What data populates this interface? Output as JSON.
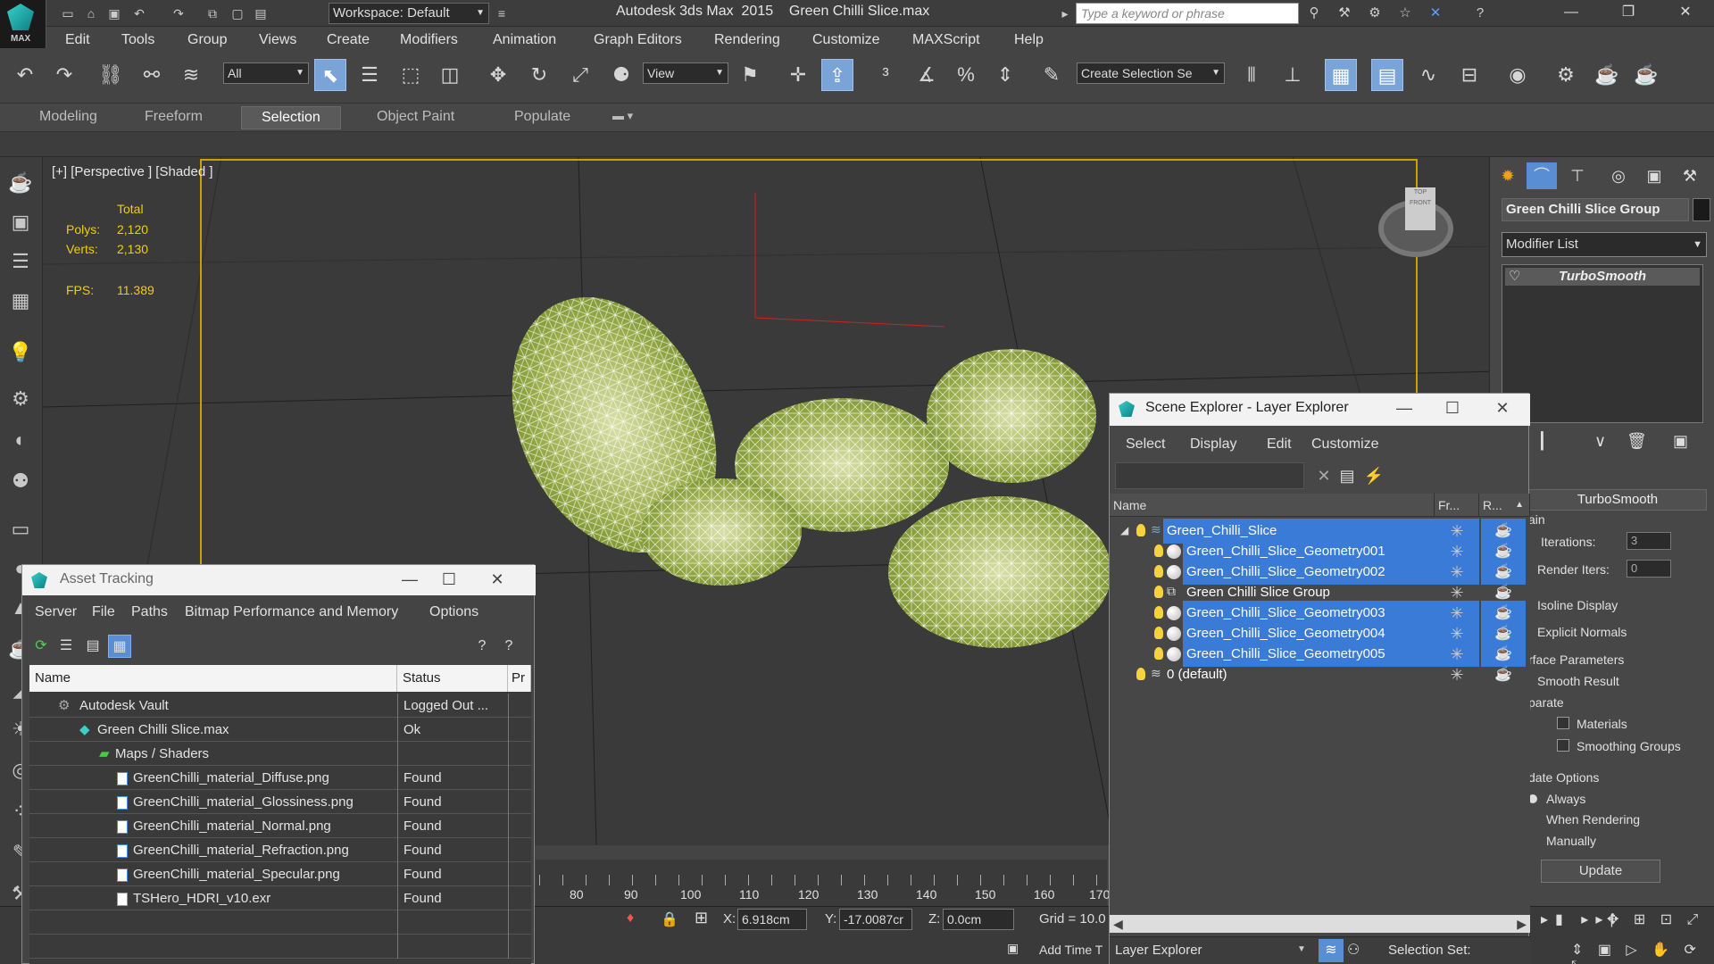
{
  "app": {
    "logo_text": "MAX",
    "title": "Autodesk 3ds Max  2015    Green Chilli Slice.max",
    "workspace": "Workspace: Default",
    "search_placeholder": "Type a keyword or phrase"
  },
  "menus": [
    "Edit",
    "Tools",
    "Group",
    "Views",
    "Create",
    "Modifiers",
    "Animation",
    "Graph Editors",
    "Rendering",
    "Customize",
    "MAXScript",
    "Help"
  ],
  "toolbar": {
    "selection_filter": "All",
    "ref_coord": "View",
    "selection_set": "Create Selection Se"
  },
  "ribbon": {
    "tabs": [
      "Modeling",
      "Freeform",
      "Selection",
      "Object Paint",
      "Populate"
    ],
    "active": "Selection"
  },
  "viewport": {
    "label": "[+] [Perspective ] [Shaded ]",
    "stats": {
      "total_label": "Total",
      "polys_label": "Polys:",
      "polys": "2,120",
      "verts_label": "Verts:",
      "verts": "2,130",
      "fps_label": "FPS:",
      "fps": "11.389"
    },
    "viewcube": {
      "top": "TOP",
      "front": "FRONT"
    }
  },
  "command_panel": {
    "object_name": "Green Chilli Slice Group",
    "modifier_list": "Modifier List",
    "stack_item": "TurboSmooth",
    "rollout_title": "TurboSmooth",
    "main_label": "ain",
    "iterations_label": "Iterations:",
    "iterations": "3",
    "render_iters_label": "Render Iters:",
    "render_iters": "0",
    "isoline": "Isoline Display",
    "explicit": "Explicit Normals",
    "surface_params": "rface Parameters",
    "smooth_result": "Smooth Result",
    "separate": "parate",
    "materials": "Materials",
    "smoothing_groups": "Smoothing Groups",
    "update_options": "date Options",
    "always": "Always",
    "when_rendering": "When Rendering",
    "manually": "Manually",
    "update_button": "Update"
  },
  "timeline": {
    "ticks": [
      "80",
      "90",
      "100",
      "110",
      "120",
      "130",
      "140",
      "150",
      "160",
      "170"
    ]
  },
  "statusbar": {
    "x_label": "X:",
    "x": "6.918cm",
    "y_label": "Y:",
    "y": "-17.0087cr",
    "z_label": "Z:",
    "z": "0.0cm",
    "grid": "Grid = 10.0",
    "add_time": "Add Time T",
    "layer_explorer": "Layer Explorer",
    "selection_set": "Selection Set:"
  },
  "asset_tracking": {
    "title": "Asset Tracking",
    "menus": [
      "Server",
      "File",
      "Paths",
      "Bitmap Performance and Memory",
      "Options"
    ],
    "columns": [
      "Name",
      "Status",
      "Pr"
    ],
    "rows": [
      {
        "name": "Autodesk Vault",
        "status": "Logged Out ...",
        "indent": 0
      },
      {
        "name": "Green Chilli Slice.max",
        "status": "Ok",
        "indent": 1
      },
      {
        "name": "Maps / Shaders",
        "status": "",
        "indent": 2
      },
      {
        "name": "GreenChilli_material_Diffuse.png",
        "status": "Found",
        "indent": 3
      },
      {
        "name": "GreenChilli_material_Glossiness.png",
        "status": "Found",
        "indent": 3
      },
      {
        "name": "GreenChilli_material_Normal.png",
        "status": "Found",
        "indent": 3
      },
      {
        "name": "GreenChilli_material_Refraction.png",
        "status": "Found",
        "indent": 3
      },
      {
        "name": "GreenChilli_material_Specular.png",
        "status": "Found",
        "indent": 3
      },
      {
        "name": "TSHero_HDRI_v10.exr",
        "status": "Found",
        "indent": 3
      }
    ]
  },
  "scene_explorer": {
    "title": "Scene Explorer - Layer Explorer",
    "menus": [
      "Select",
      "Display",
      "Edit",
      "Customize"
    ],
    "columns": [
      "Name",
      "Fr...",
      "R..."
    ],
    "rows": [
      {
        "name": "Green_Chilli_Slice",
        "level": 0,
        "highlight": true,
        "kind": "layer"
      },
      {
        "name": "Green_Chilli_Slice_Geometry001",
        "level": 1,
        "highlight": true,
        "kind": "mesh"
      },
      {
        "name": "Green_Chilli_Slice_Geometry002",
        "level": 1,
        "highlight": true,
        "kind": "mesh"
      },
      {
        "name": "Green Chilli Slice Group",
        "level": 1,
        "highlight": false,
        "kind": "group"
      },
      {
        "name": "Green_Chilli_Slice_Geometry003",
        "level": 1,
        "highlight": true,
        "kind": "mesh"
      },
      {
        "name": "Green_Chilli_Slice_Geometry004",
        "level": 1,
        "highlight": true,
        "kind": "mesh"
      },
      {
        "name": "Green_Chilli_Slice_Geometry005",
        "level": 1,
        "highlight": true,
        "kind": "mesh"
      },
      {
        "name": "0 (default)",
        "level": 0,
        "highlight": false,
        "kind": "layer"
      }
    ]
  }
}
